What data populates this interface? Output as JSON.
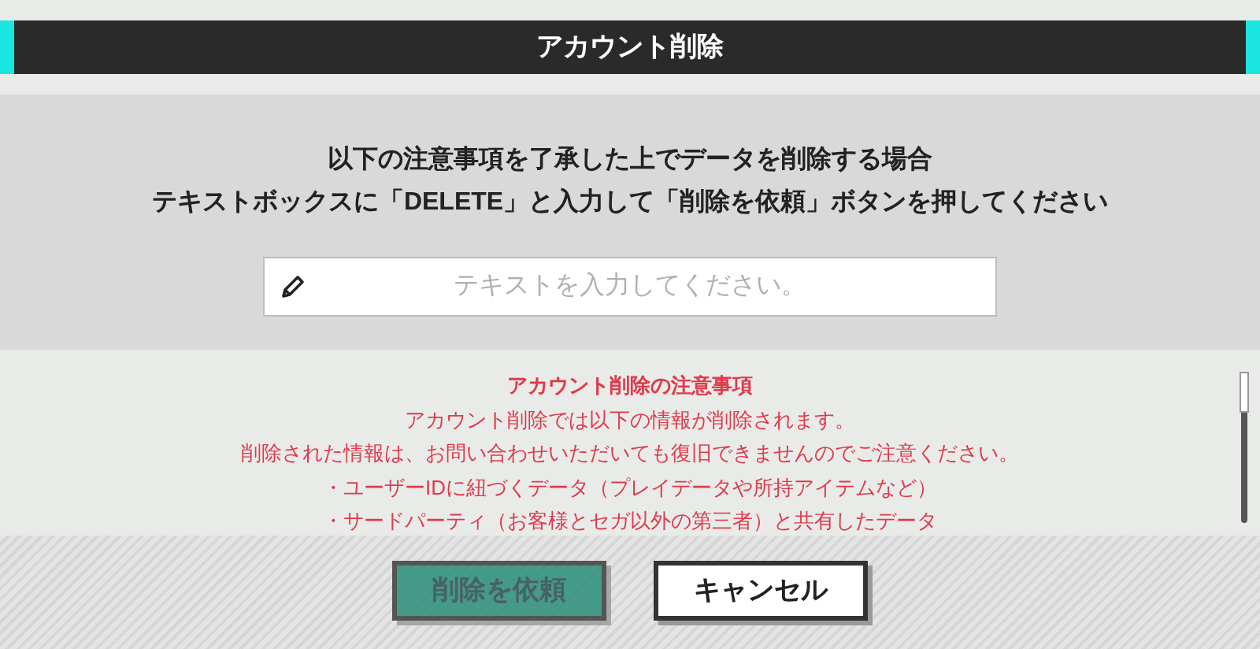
{
  "window": {
    "title": "アカウント削除"
  },
  "instructions": [
    "以下の注意事項を了承した上でデータを削除する場合",
    "テキストボックスに「DELETE」と入力して「削除を依頼」ボタンを押してください"
  ],
  "text_field": {
    "placeholder": "テキストを入力してください。"
  },
  "notice": {
    "heading": "アカウント削除の注意事項",
    "lines": [
      "アカウント削除では以下の情報が削除されます。",
      "削除された情報は、お問い合わせいただいても復旧できませんのでご注意ください。",
      "・ユーザーIDに紐づくデータ（プレイデータや所持アイテムなど）",
      "・サードパーティ（お客様とセガ以外の第三者）と共有したデータ"
    ]
  },
  "buttons": [
    {
      "label": "削除を依頼",
      "kind": "primary",
      "disabled": true
    },
    {
      "label": "キャンセル",
      "kind": "secondary",
      "disabled": false
    }
  ]
}
